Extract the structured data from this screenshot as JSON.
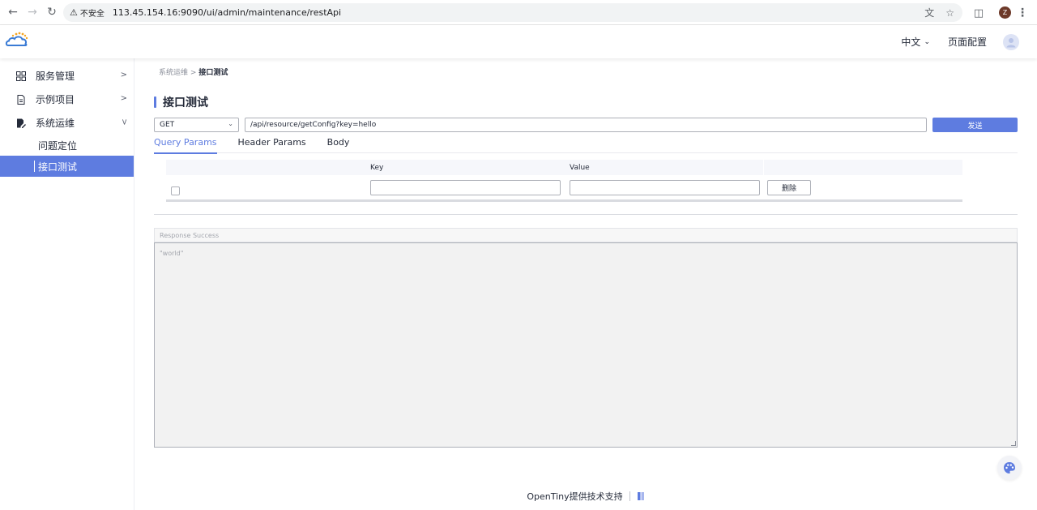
{
  "browser": {
    "security_label": "不安全",
    "url": "113.45.154.16:9090/ui/admin/maintenance/restApi",
    "profile_initial": "Z"
  },
  "header": {
    "language": "中文",
    "page_config": "页面配置"
  },
  "sidebar": {
    "items": [
      {
        "label": "服务管理",
        "icon": "grid-icon",
        "expanded": false
      },
      {
        "label": "示例项目",
        "icon": "document-icon",
        "expanded": false
      },
      {
        "label": "系统运维",
        "icon": "edit-document-icon",
        "expanded": true
      }
    ],
    "sub_items": [
      {
        "label": "问题定位",
        "active": false
      },
      {
        "label": "接口测试",
        "active": true
      }
    ]
  },
  "breadcrumb": {
    "parent": "系统运维",
    "separator": ">",
    "current": "接口测试"
  },
  "page": {
    "title": "接口测试"
  },
  "request": {
    "method": "GET",
    "url": "/api/resource/getConfig?key=hello",
    "send_label": "发送"
  },
  "tabs": [
    {
      "label": "Query Params",
      "active": true
    },
    {
      "label": "Header Params",
      "active": false
    },
    {
      "label": "Body",
      "active": false
    }
  ],
  "params_table": {
    "headers": {
      "key": "Key",
      "value": "Value"
    },
    "rows": [
      {
        "key": "",
        "value": "",
        "delete_label": "删除"
      }
    ]
  },
  "response": {
    "status": "Response Success",
    "body": "\"world\""
  },
  "footer": {
    "text": "OpenTiny提供技术支持"
  },
  "colors": {
    "accent": "#5e7ce0",
    "text": "#252b3a"
  }
}
